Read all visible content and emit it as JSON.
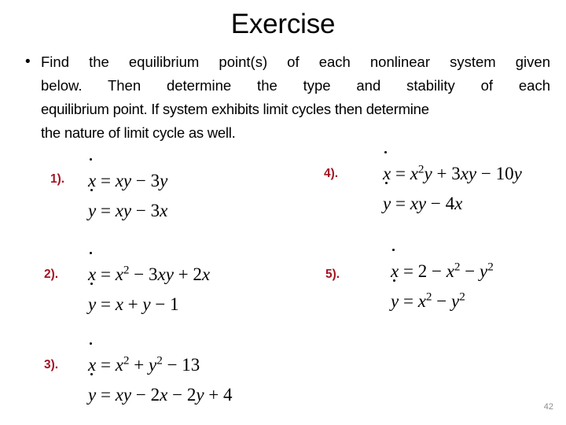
{
  "slide": {
    "title": "Exercise",
    "page_number": "42",
    "background_color": "#ffffff",
    "accent_color": "#A41322",
    "page_number_color": "#8c8c8c"
  },
  "body": {
    "bullet_marker": "•",
    "full_text": "Find the equilibrium point(s) of each nonlinear system given below. Then determine the type and stability of each equilibrium point. If system exhibits limit cycles then determine the nature of limit cycle as well.",
    "lines": [
      "Find the equilibrium point(s) of each nonlinear system given",
      "below. Then determine the type and stability of each",
      "equilibrium point. If system exhibits limit cycles then determine",
      "the nature of limit cycle as well."
    ]
  },
  "exercises": [
    {
      "label": "1).",
      "xdot_lhs": "x",
      "xdot_rhs": "= xy − 3y",
      "ydot_lhs": "y",
      "ydot_rhs": "= xy − 3x",
      "xdot_plain": "ẋ = xy − 3y",
      "ydot_plain": "ẏ = xy − 3x"
    },
    {
      "label": "2).",
      "xdot_lhs": "x",
      "xdot_rhs": "= x² − 3xy + 2x",
      "ydot_lhs": "y",
      "ydot_rhs": "= x + y − 1",
      "xdot_plain": "ẋ = x² − 3xy + 2x",
      "ydot_plain": "ẏ = x + y − 1"
    },
    {
      "label": "3).",
      "xdot_lhs": "x",
      "xdot_rhs": "= x² + y² − 13",
      "ydot_lhs": "y",
      "ydot_rhs": "= xy − 2x − 2y + 4",
      "xdot_plain": "ẋ = x² + y² − 13",
      "ydot_plain": "ẏ = xy − 2x − 2y + 4"
    },
    {
      "label": "4).",
      "xdot_lhs": "x",
      "xdot_rhs": "= x²y + 3xy − 10y",
      "ydot_lhs": "y",
      "ydot_rhs": "= xy − 4x",
      "xdot_plain": "ẋ = x²y + 3xy − 10y",
      "ydot_plain": "ẏ = xy − 4x"
    },
    {
      "label": "5).",
      "xdot_lhs": "x",
      "xdot_rhs": "= 2 − x² − y²",
      "ydot_lhs": "y",
      "ydot_rhs": "= x² − y²",
      "xdot_plain": "ẋ = 2 − x² − y²",
      "ydot_plain": "ẏ = x² − y²"
    }
  ]
}
